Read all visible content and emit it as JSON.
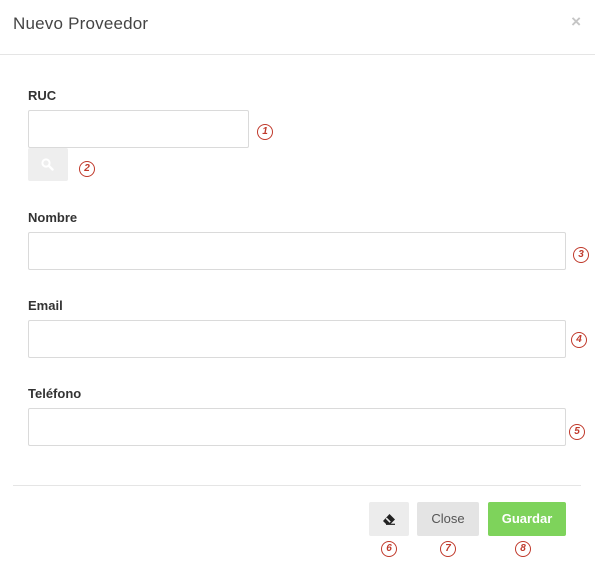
{
  "dialog": {
    "title": "Nuevo Proveedor",
    "close_icon": "×"
  },
  "form": {
    "ruc": {
      "label": "RUC",
      "value": ""
    },
    "search_icon": "search-icon",
    "nombre": {
      "label": "Nombre",
      "value": ""
    },
    "email": {
      "label": "Email",
      "value": ""
    },
    "telefono": {
      "label": "Teléfono",
      "value": ""
    }
  },
  "footer": {
    "eraser_icon": "eraser-icon",
    "close_label": "Close",
    "save_label": "Guardar"
  },
  "annotations": [
    "1",
    "2",
    "3",
    "4",
    "5",
    "6",
    "7",
    "8"
  ],
  "colors": {
    "annotation": "#c0392b",
    "save_button": "#7ed35b"
  }
}
